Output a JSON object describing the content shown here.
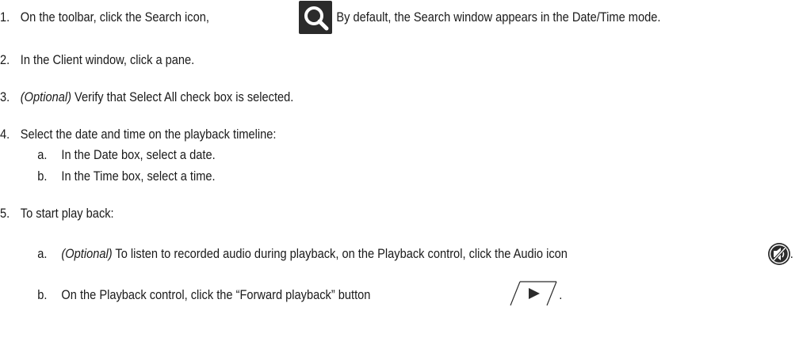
{
  "steps": [
    {
      "number": "1.",
      "text_before": "On the toolbar, click the Search icon,",
      "icon": "search-icon",
      "text_after": ". By default, the Search window appears in the Date/Time mode."
    },
    {
      "number": "2.",
      "text": "In the Client window, click a pane."
    },
    {
      "number": "3.",
      "optional": "(Optional)",
      "text": " Verify that Select All check box is selected."
    },
    {
      "number": "4.",
      "text": "Select the date and time on the playback timeline:",
      "substeps": [
        {
          "letter": "a.",
          "text": "In the Date box, select a date."
        },
        {
          "letter": "b.",
          "text": "In the Time box, select a time."
        }
      ]
    },
    {
      "number": "5.",
      "text": "To start play back:",
      "substeps": [
        {
          "letter": "a.",
          "optional": "(Optional)",
          "text": " To listen to recorded audio during playback, on the Playback control, click the Audio icon",
          "icon": "audio-muted-icon",
          "text_after": "."
        },
        {
          "letter": "b.",
          "text": "On the Playback control, click the “Forward playback” button",
          "icon": "forward-playback-icon",
          "text_after": "."
        }
      ]
    }
  ],
  "colors": {
    "text": "#1a1a1a",
    "icon_dark": "#2b2b2b",
    "icon_light": "#ffffff"
  }
}
